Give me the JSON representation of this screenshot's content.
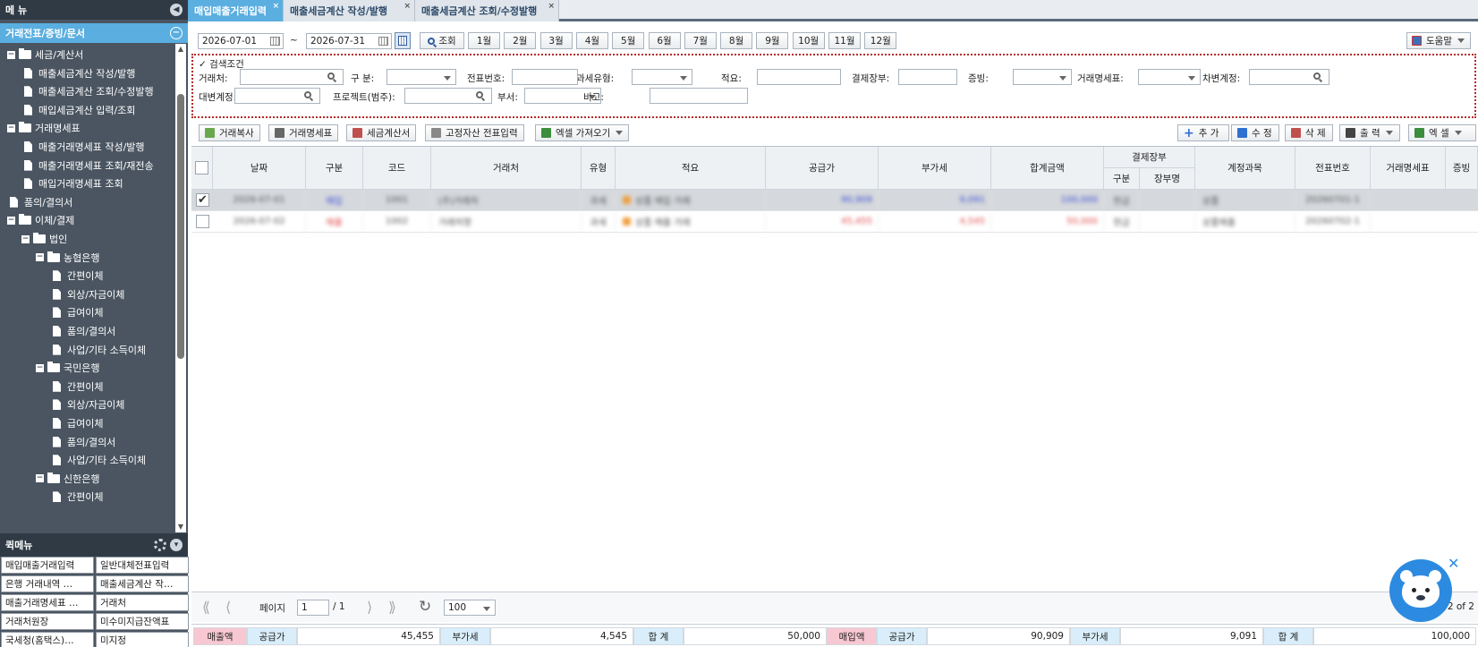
{
  "sidebar": {
    "menu_title": "메 뉴",
    "section_title": "거래전표/증빙/문서",
    "tree": [
      {
        "label": "세금/계산서",
        "type": "folder",
        "depth": 0
      },
      {
        "label": "매출세금계산 작성/발행",
        "type": "doc",
        "depth": 1
      },
      {
        "label": "매출세금계산 조회/수정발행",
        "type": "doc",
        "depth": 1
      },
      {
        "label": "매입세금계산 입력/조회",
        "type": "doc",
        "depth": 1
      },
      {
        "label": "거래명세표",
        "type": "folder",
        "depth": 0
      },
      {
        "label": "매출거래명세표 작성/발행",
        "type": "doc",
        "depth": 1
      },
      {
        "label": "매출거래명세표 조회/재전송",
        "type": "doc",
        "depth": 1
      },
      {
        "label": "매입거래명세표 조회",
        "type": "doc",
        "depth": 1
      },
      {
        "label": "품의/결의서",
        "type": "doc",
        "depth": 0
      },
      {
        "label": "이체/결제",
        "type": "folder",
        "depth": 0
      },
      {
        "label": "법인",
        "type": "folder",
        "depth": 1
      },
      {
        "label": "농협은행",
        "type": "folder",
        "depth": 2
      },
      {
        "label": "간편이체",
        "type": "doc",
        "depth": 3
      },
      {
        "label": "외상/자금이체",
        "type": "doc",
        "depth": 3
      },
      {
        "label": "급여이체",
        "type": "doc",
        "depth": 3
      },
      {
        "label": "품의/결의서",
        "type": "doc",
        "depth": 3
      },
      {
        "label": "사업/기타 소득이체",
        "type": "doc",
        "depth": 3
      },
      {
        "label": "국민은행",
        "type": "folder",
        "depth": 2
      },
      {
        "label": "간편이체",
        "type": "doc",
        "depth": 3
      },
      {
        "label": "외상/자금이체",
        "type": "doc",
        "depth": 3
      },
      {
        "label": "급여이체",
        "type": "doc",
        "depth": 3
      },
      {
        "label": "품의/결의서",
        "type": "doc",
        "depth": 3
      },
      {
        "label": "사업/기타 소득이체",
        "type": "doc",
        "depth": 3
      },
      {
        "label": "신한은행",
        "type": "folder",
        "depth": 2
      },
      {
        "label": "간편이체",
        "type": "doc",
        "depth": 3
      }
    ],
    "quick_title": "퀵메뉴",
    "quick_items": [
      "매입매출거래입력",
      "일반대체전표입력",
      "은행 거래내역 …",
      "매출세금계산 작…",
      "매출거래명세표 …",
      "거래처",
      "거래처원장",
      "미수미지급잔액표",
      "국세청(홈택스)…",
      "미지정"
    ]
  },
  "tabs": [
    {
      "label": "매입매출거래입력",
      "active": true
    },
    {
      "label": "매출세금계산 작성/발행",
      "active": false
    },
    {
      "label": "매출세금계산 조회/수정발행",
      "active": false
    }
  ],
  "toolbar": {
    "date_from": "2026-07-01",
    "tilde": "~",
    "date_to": "2026-07-31",
    "search_label": "조회",
    "months": [
      "1월",
      "2월",
      "3월",
      "4월",
      "5월",
      "6월",
      "7월",
      "8월",
      "9월",
      "10월",
      "11월",
      "12월"
    ],
    "help_label": "도움말"
  },
  "filters": {
    "section_label": "검색조건",
    "checkmark": "✓",
    "row1": [
      "거래처:",
      "구 분:",
      "전표번호:",
      "과세유형:",
      "적요:",
      "결제장부:",
      "증빙:",
      "거래명세표:",
      "차변계정:"
    ],
    "row2": [
      "대변계정:",
      "프로젝트(범주):",
      "부서:",
      "비고:"
    ]
  },
  "actions": {
    "left": [
      "거래복사",
      "거래명세표",
      "세금계산서",
      "고정자산 전표입력",
      "엑셀 가져오기"
    ],
    "right": [
      "추 가",
      "수 정",
      "삭 제",
      "출 력",
      "엑 셀"
    ]
  },
  "grid": {
    "headers": [
      "날짜",
      "구분",
      "코드",
      "거래처",
      "유형",
      "적요",
      "공급가",
      "부가세",
      "합계금액",
      "결제장부",
      "구분",
      "장부명",
      "계정과목",
      "전표번호",
      "거래명세표",
      "증빙"
    ],
    "rows": [
      {
        "checked": true,
        "checkmark": "✔",
        "date": "2026-07-01",
        "kind": "매입",
        "code": "1001",
        "vendor": "(주)거래처",
        "type": "과세",
        "memo": "상품 매입 거래",
        "supply": "90,909",
        "vat": "9,091",
        "total": "100,000",
        "pay_kind": "현금",
        "ledger": "",
        "account": "상품",
        "slip": "20260701-1",
        "color": "#3f4fd6"
      },
      {
        "checked": false,
        "checkmark": "",
        "date": "2026-07-02",
        "kind": "매출",
        "code": "1002",
        "vendor": "거래처명",
        "type": "과세",
        "memo": "상품 매출 거래",
        "supply": "45,455",
        "vat": "4,545",
        "total": "50,000",
        "pay_kind": "현금",
        "ledger": "",
        "account": "상품매출",
        "slip": "20260702-1",
        "color": "#e04a4a"
      }
    ]
  },
  "pager": {
    "page_label": "페이지",
    "page_value": "1",
    "page_total": "/ 1",
    "page_size": "100",
    "count": "2 of 2",
    "first": "⟪",
    "prev": "⟨",
    "next": "⟩",
    "last": "⟫",
    "refresh": "↻"
  },
  "totals": {
    "sales_label": "매출액",
    "sales_supply_label": "공급가",
    "sales_supply": "45,455",
    "sales_vat_label": "부가세",
    "sales_vat": "4,545",
    "sales_total_label": "합 계",
    "sales_total": "50,000",
    "purchase_label": "매입액",
    "purchase_supply_label": "공급가",
    "purchase_supply": "90,909",
    "purchase_vat_label": "부가세",
    "purchase_vat": "9,091",
    "purchase_total_label": "합 계",
    "purchase_total": "100,000"
  },
  "icons": {
    "collapse": "◀",
    "minus": "−",
    "chevron_down": "▾",
    "close": "×",
    "chat_close": "✕",
    "plus": "+"
  },
  "colors": {
    "accent": "#5aaee0",
    "sidebar": "#4a5561",
    "dotted_border": "#b42a2a",
    "pink": "#f7c7d2",
    "light_blue": "#d9eefa"
  }
}
